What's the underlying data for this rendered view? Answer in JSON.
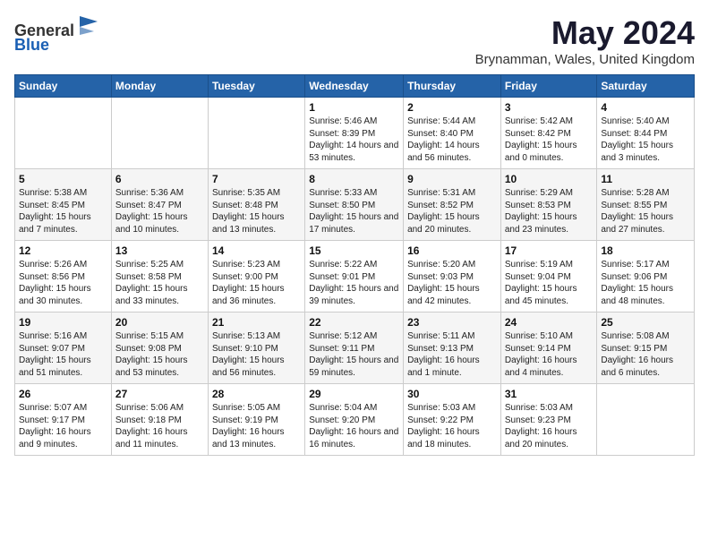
{
  "logo": {
    "line1": "General",
    "line2": "Blue"
  },
  "title": "May 2024",
  "subtitle": "Brynamman, Wales, United Kingdom",
  "headers": [
    "Sunday",
    "Monday",
    "Tuesday",
    "Wednesday",
    "Thursday",
    "Friday",
    "Saturday"
  ],
  "weeks": [
    [
      {
        "day": "",
        "info": ""
      },
      {
        "day": "",
        "info": ""
      },
      {
        "day": "",
        "info": ""
      },
      {
        "day": "1",
        "info": "Sunrise: 5:46 AM\nSunset: 8:39 PM\nDaylight: 14 hours\nand 53 minutes."
      },
      {
        "day": "2",
        "info": "Sunrise: 5:44 AM\nSunset: 8:40 PM\nDaylight: 14 hours\nand 56 minutes."
      },
      {
        "day": "3",
        "info": "Sunrise: 5:42 AM\nSunset: 8:42 PM\nDaylight: 15 hours\nand 0 minutes."
      },
      {
        "day": "4",
        "info": "Sunrise: 5:40 AM\nSunset: 8:44 PM\nDaylight: 15 hours\nand 3 minutes."
      }
    ],
    [
      {
        "day": "5",
        "info": "Sunrise: 5:38 AM\nSunset: 8:45 PM\nDaylight: 15 hours\nand 7 minutes."
      },
      {
        "day": "6",
        "info": "Sunrise: 5:36 AM\nSunset: 8:47 PM\nDaylight: 15 hours\nand 10 minutes."
      },
      {
        "day": "7",
        "info": "Sunrise: 5:35 AM\nSunset: 8:48 PM\nDaylight: 15 hours\nand 13 minutes."
      },
      {
        "day": "8",
        "info": "Sunrise: 5:33 AM\nSunset: 8:50 PM\nDaylight: 15 hours\nand 17 minutes."
      },
      {
        "day": "9",
        "info": "Sunrise: 5:31 AM\nSunset: 8:52 PM\nDaylight: 15 hours\nand 20 minutes."
      },
      {
        "day": "10",
        "info": "Sunrise: 5:29 AM\nSunset: 8:53 PM\nDaylight: 15 hours\nand 23 minutes."
      },
      {
        "day": "11",
        "info": "Sunrise: 5:28 AM\nSunset: 8:55 PM\nDaylight: 15 hours\nand 27 minutes."
      }
    ],
    [
      {
        "day": "12",
        "info": "Sunrise: 5:26 AM\nSunset: 8:56 PM\nDaylight: 15 hours\nand 30 minutes."
      },
      {
        "day": "13",
        "info": "Sunrise: 5:25 AM\nSunset: 8:58 PM\nDaylight: 15 hours\nand 33 minutes."
      },
      {
        "day": "14",
        "info": "Sunrise: 5:23 AM\nSunset: 9:00 PM\nDaylight: 15 hours\nand 36 minutes."
      },
      {
        "day": "15",
        "info": "Sunrise: 5:22 AM\nSunset: 9:01 PM\nDaylight: 15 hours\nand 39 minutes."
      },
      {
        "day": "16",
        "info": "Sunrise: 5:20 AM\nSunset: 9:03 PM\nDaylight: 15 hours\nand 42 minutes."
      },
      {
        "day": "17",
        "info": "Sunrise: 5:19 AM\nSunset: 9:04 PM\nDaylight: 15 hours\nand 45 minutes."
      },
      {
        "day": "18",
        "info": "Sunrise: 5:17 AM\nSunset: 9:06 PM\nDaylight: 15 hours\nand 48 minutes."
      }
    ],
    [
      {
        "day": "19",
        "info": "Sunrise: 5:16 AM\nSunset: 9:07 PM\nDaylight: 15 hours\nand 51 minutes."
      },
      {
        "day": "20",
        "info": "Sunrise: 5:15 AM\nSunset: 9:08 PM\nDaylight: 15 hours\nand 53 minutes."
      },
      {
        "day": "21",
        "info": "Sunrise: 5:13 AM\nSunset: 9:10 PM\nDaylight: 15 hours\nand 56 minutes."
      },
      {
        "day": "22",
        "info": "Sunrise: 5:12 AM\nSunset: 9:11 PM\nDaylight: 15 hours\nand 59 minutes."
      },
      {
        "day": "23",
        "info": "Sunrise: 5:11 AM\nSunset: 9:13 PM\nDaylight: 16 hours\nand 1 minute."
      },
      {
        "day": "24",
        "info": "Sunrise: 5:10 AM\nSunset: 9:14 PM\nDaylight: 16 hours\nand 4 minutes."
      },
      {
        "day": "25",
        "info": "Sunrise: 5:08 AM\nSunset: 9:15 PM\nDaylight: 16 hours\nand 6 minutes."
      }
    ],
    [
      {
        "day": "26",
        "info": "Sunrise: 5:07 AM\nSunset: 9:17 PM\nDaylight: 16 hours\nand 9 minutes."
      },
      {
        "day": "27",
        "info": "Sunrise: 5:06 AM\nSunset: 9:18 PM\nDaylight: 16 hours\nand 11 minutes."
      },
      {
        "day": "28",
        "info": "Sunrise: 5:05 AM\nSunset: 9:19 PM\nDaylight: 16 hours\nand 13 minutes."
      },
      {
        "day": "29",
        "info": "Sunrise: 5:04 AM\nSunset: 9:20 PM\nDaylight: 16 hours\nand 16 minutes."
      },
      {
        "day": "30",
        "info": "Sunrise: 5:03 AM\nSunset: 9:22 PM\nDaylight: 16 hours\nand 18 minutes."
      },
      {
        "day": "31",
        "info": "Sunrise: 5:03 AM\nSunset: 9:23 PM\nDaylight: 16 hours\nand 20 minutes."
      },
      {
        "day": "",
        "info": ""
      }
    ]
  ]
}
